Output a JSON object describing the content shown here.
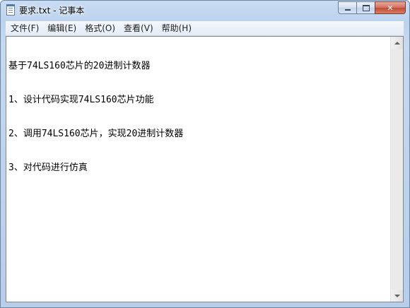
{
  "window": {
    "title": "要求.txt - 记事本"
  },
  "menu": [
    {
      "label": "文件(F)"
    },
    {
      "label": "编辑(E)"
    },
    {
      "label": "格式(O)"
    },
    {
      "label": "查看(V)"
    },
    {
      "label": "帮助(H)"
    }
  ],
  "document": {
    "lines": [
      "基于74LS160芯片的20进制计数器",
      "1、设计代码实现74LS160芯片功能",
      "2、调用74LS160芯片，实现20进制计数器",
      "3、对代码进行仿真"
    ]
  },
  "icons": {
    "app": "notepad-icon",
    "minimize": "minimize-icon",
    "maximize": "maximize-icon",
    "close": "close-icon",
    "scroll_up": "scroll-up-arrow-icon",
    "scroll_down": "scroll-down-arrow-icon"
  },
  "colors": {
    "close_button": "#c24c35",
    "title_bar": "#bcd3ee"
  }
}
